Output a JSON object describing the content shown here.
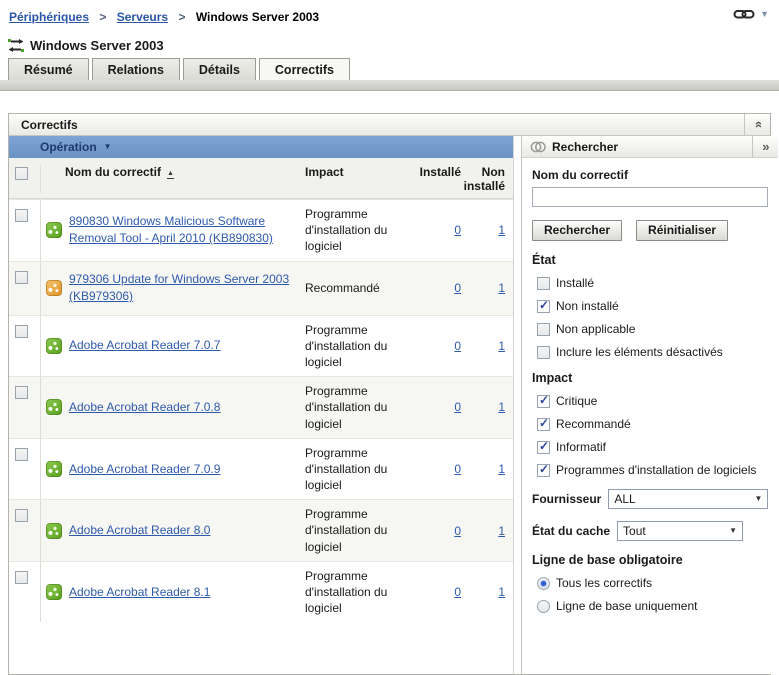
{
  "breadcrumb": {
    "separator": ">",
    "items": [
      {
        "label": "Périphériques"
      },
      {
        "label": "Serveurs"
      },
      {
        "label": "Windows Server 2003"
      }
    ]
  },
  "device": {
    "title": "Windows Server 2003",
    "icon": "device-transfer-icon"
  },
  "tabs": [
    {
      "label": "Résumé",
      "active": false
    },
    {
      "label": "Relations",
      "active": false
    },
    {
      "label": "Détails",
      "active": false
    },
    {
      "label": "Correctifs",
      "active": true
    }
  ],
  "panel": {
    "title": "Correctifs",
    "collapse_icon": "collapse-up-icon"
  },
  "action_bar": {
    "label": "Opération",
    "arrow_icon": "dropdown-arrow-icon"
  },
  "table": {
    "headers": {
      "name": "Nom du correctif",
      "impact": "Impact",
      "installed": "Installé",
      "not_installed": "Non installé"
    },
    "sort": {
      "column": "name",
      "direction": "ascending",
      "icon": "sort-ascending-icon"
    },
    "rows": [
      {
        "name": "890830 Windows Malicious Software Removal Tool - April 2010 (KB890830)",
        "impact": "Programme d'installation du logiciel",
        "installed": "0",
        "not_installed": "1",
        "icon": "patch-green-icon",
        "checked": false
      },
      {
        "name": "979306 Update for Windows Server 2003 (KB979306)",
        "impact": "Recommandé",
        "installed": "0",
        "not_installed": "1",
        "icon": "patch-orange-icon",
        "checked": false
      },
      {
        "name": "Adobe Acrobat Reader 7.0.7",
        "impact": "Programme d'installation du logiciel",
        "installed": "0",
        "not_installed": "1",
        "icon": "patch-green-icon",
        "checked": false
      },
      {
        "name": "Adobe Acrobat Reader 7.0.8",
        "impact": "Programme d'installation du logiciel",
        "installed": "0",
        "not_installed": "1",
        "icon": "patch-green-icon",
        "checked": false
      },
      {
        "name": "Adobe Acrobat Reader 7.0.9",
        "impact": "Programme d'installation du logiciel",
        "installed": "0",
        "not_installed": "1",
        "icon": "patch-green-icon",
        "checked": false
      },
      {
        "name": "Adobe Acrobat Reader 8.0",
        "impact": "Programme d'installation du logiciel",
        "installed": "0",
        "not_installed": "1",
        "icon": "patch-green-icon",
        "checked": false
      },
      {
        "name": "Adobe Acrobat Reader 8.1",
        "impact": "Programme d'installation du logiciel",
        "installed": "0",
        "not_installed": "1",
        "icon": "patch-green-icon",
        "checked": false
      }
    ]
  },
  "search_panel": {
    "title": "Rechercher",
    "title_icon": "search-icon",
    "expand_icon": "expand-right-icon",
    "field_label": "Nom du correctif",
    "field_value": "",
    "search_button": "Rechercher",
    "reset_button": "Réinitialiser",
    "etat": {
      "title": "État",
      "options": [
        {
          "label": "Installé",
          "checked": false
        },
        {
          "label": "Non installé",
          "checked": true
        },
        {
          "label": "Non applicable",
          "checked": false
        },
        {
          "label": "Inclure les éléments désactivés",
          "checked": false
        }
      ]
    },
    "impact": {
      "title": "Impact",
      "options": [
        {
          "label": "Critique",
          "checked": true
        },
        {
          "label": "Recommandé",
          "checked": true
        },
        {
          "label": "Informatif",
          "checked": true
        },
        {
          "label": "Programmes d'installation de logiciels",
          "checked": true
        }
      ]
    },
    "fournisseur": {
      "label": "Fournisseur",
      "value": "ALL"
    },
    "cache": {
      "label": "État du cache",
      "value": "Tout"
    },
    "baseline": {
      "title": "Ligne de base obligatoire",
      "options": [
        {
          "label": "Tous les correctifs",
          "selected": true
        },
        {
          "label": "Ligne de base uniquement",
          "selected": false
        }
      ]
    }
  },
  "top_icons": {
    "link": "chain-link-icon",
    "dropdown": "dropdown-arrow-icon"
  },
  "colors": {
    "action_bar_bg": "#7197cd",
    "action_bar_text": "#1c3a6e",
    "link": "#2e5aad",
    "row_alt_bg": "#f6f6f3",
    "patch_green": "#6fb32b",
    "patch_orange": "#eda43c",
    "panel_border": "#b3b3ad",
    "tab_active_bg": "#f7f7f4"
  }
}
